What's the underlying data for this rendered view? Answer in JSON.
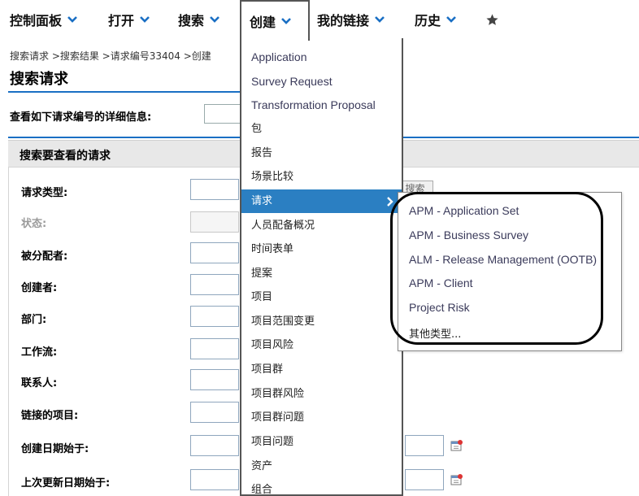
{
  "topnav": {
    "items": [
      {
        "label": "控制面板"
      },
      {
        "label": "打开"
      },
      {
        "label": "搜索"
      },
      {
        "label": "创建"
      },
      {
        "label": "我的链接"
      },
      {
        "label": "历史"
      }
    ],
    "accent_color": "#1a6fc4"
  },
  "breadcrumb": "搜索请求 >搜索结果 >请求编号33404 >创建",
  "page_title": "搜索请求",
  "lookup_label": "查看如下请求编号的详细信息:",
  "section_title": "搜索要查看的请求",
  "search_button_label": "搜索",
  "form": {
    "fields": [
      {
        "label": "请求类型:"
      },
      {
        "label": "状态:"
      },
      {
        "label": "被分配者:"
      },
      {
        "label": "创建者:"
      },
      {
        "label": "部门:"
      },
      {
        "label": "工作流:"
      },
      {
        "label": "联系人:"
      },
      {
        "label": "链接的项目:"
      },
      {
        "label": "创建日期始于:"
      },
      {
        "label": "上次更新日期始于:"
      }
    ]
  },
  "create_menu": {
    "items": [
      {
        "label": "Application"
      },
      {
        "label": "Survey Request"
      },
      {
        "label": "Transformation Proposal"
      },
      {
        "label": "包"
      },
      {
        "label": "报告"
      },
      {
        "label": "场景比较"
      },
      {
        "label": "请求"
      },
      {
        "label": "人员配备概况"
      },
      {
        "label": "时间表单"
      },
      {
        "label": "提案"
      },
      {
        "label": "项目"
      },
      {
        "label": "项目范围变更"
      },
      {
        "label": "项目风险"
      },
      {
        "label": "项目群"
      },
      {
        "label": "项目群风险"
      },
      {
        "label": "项目群问题"
      },
      {
        "label": "项目问题"
      },
      {
        "label": "资产"
      },
      {
        "label": "组合"
      }
    ],
    "selected_color": "#2b7fc2"
  },
  "request_submenu": {
    "items": [
      {
        "label": "APM - Application Set"
      },
      {
        "label": "APM - Business Survey"
      },
      {
        "label": "ALM - Release Management (OOTB)"
      },
      {
        "label": "APM - Client"
      },
      {
        "label": "Project Risk"
      },
      {
        "label": "其他类型..."
      }
    ]
  }
}
